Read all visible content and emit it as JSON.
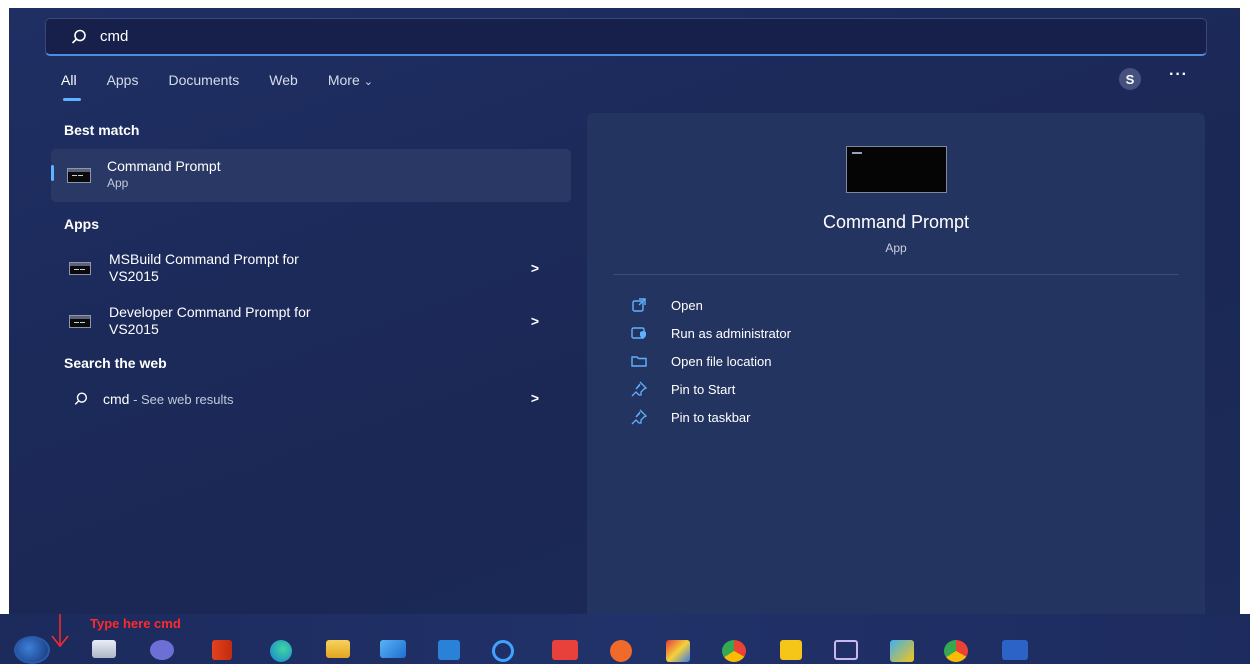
{
  "search": {
    "value": "cmd",
    "placeholder": ""
  },
  "tabs": [
    {
      "label": "All"
    },
    {
      "label": "Apps"
    },
    {
      "label": "Documents"
    },
    {
      "label": "Web"
    },
    {
      "label": "More"
    }
  ],
  "user": {
    "initial": "S",
    "more": "···"
  },
  "best_match": {
    "heading": "Best match",
    "title": "Command Prompt",
    "subtitle": "App"
  },
  "apps": {
    "heading": "Apps",
    "items": [
      {
        "line1": "MSBuild Command Prompt for",
        "line2": "VS2015",
        "arrow": ">"
      },
      {
        "line1": "Developer Command Prompt for",
        "line2": "VS2015",
        "arrow": ">"
      }
    ]
  },
  "web": {
    "heading": "Search the web",
    "query": "cmd",
    "suffix": " - See web results",
    "arrow": ">"
  },
  "detail": {
    "title": "Command Prompt",
    "subtitle": "App",
    "actions": [
      {
        "label": "Open",
        "icon": "open-icon"
      },
      {
        "label": "Run as administrator",
        "icon": "admin-shield-icon"
      },
      {
        "label": "Open file location",
        "icon": "folder-icon"
      },
      {
        "label": "Pin to Start",
        "icon": "pin-icon"
      },
      {
        "label": "Pin to taskbar",
        "icon": "pin-icon"
      }
    ]
  },
  "annotation": {
    "text": "Type here cmd"
  },
  "colors": {
    "accent": "#5fb2ff",
    "panel": "#1c2a5a",
    "annotation": "#ff2a2a"
  },
  "taskbar_icons": [
    "start-search-icon",
    "task-view-icon",
    "chat-icon",
    "office-icon",
    "edge-icon",
    "file-explorer-icon",
    "mail-icon",
    "l-app-icon",
    "cortana-icon",
    "anydesk-icon",
    "postman-icon",
    "paint-icon",
    "chrome-icon",
    "sticky-notes-icon",
    "visual-studio-icon",
    "photos-icon",
    "chrome-icon-2",
    "word-icon"
  ]
}
